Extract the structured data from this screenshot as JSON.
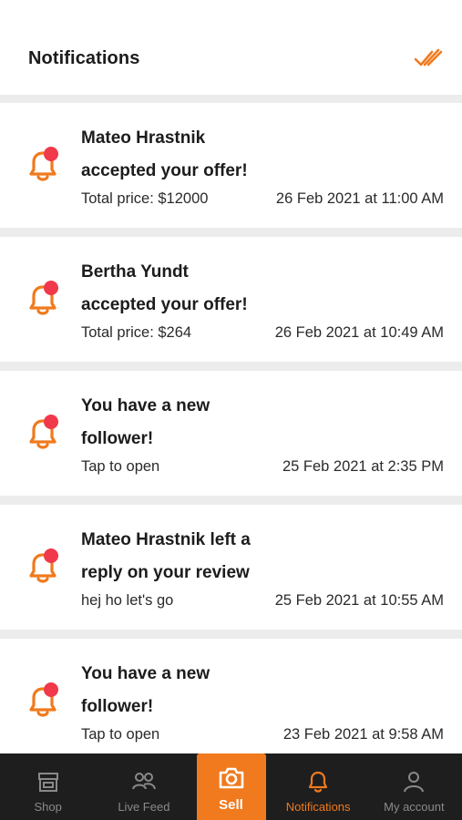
{
  "header": {
    "title": "Notifications"
  },
  "notifications": [
    {
      "line1": "Mateo Hrastnik",
      "line2": "accepted your offer!",
      "sub": "Total price: $12000",
      "date": "26 Feb 2021 at 11:00 AM"
    },
    {
      "line1": "Bertha Yundt",
      "line2": "accepted your offer!",
      "sub": "Total price: $264",
      "date": "26 Feb 2021 at 10:49 AM"
    },
    {
      "line1": "You have a new",
      "line2": "follower!",
      "sub": "Tap to open",
      "date": "25 Feb 2021 at 2:35 PM"
    },
    {
      "line1": "Mateo Hrastnik left a",
      "line2": "reply on your review",
      "sub": "hej ho let's go",
      "date": "25 Feb 2021 at 10:55 AM"
    },
    {
      "line1": "You have a new",
      "line2": "follower!",
      "sub": "Tap to open",
      "date": "23 Feb 2021 at 9:58 AM"
    }
  ],
  "tabbar": {
    "tabs": [
      {
        "label": "Shop",
        "icon": "store-icon"
      },
      {
        "label": "Live Feed",
        "icon": "people-icon"
      },
      {
        "label": "Sell",
        "icon": "camera-icon"
      },
      {
        "label": "Notifications",
        "icon": "bell-icon"
      },
      {
        "label": "My account",
        "icon": "person-icon"
      }
    ],
    "active": "Notifications"
  },
  "colors": {
    "accent": "#f07a1d",
    "badge": "#f0394a",
    "tabbar_bg": "#1e1e1e",
    "separator": "#ececec"
  }
}
